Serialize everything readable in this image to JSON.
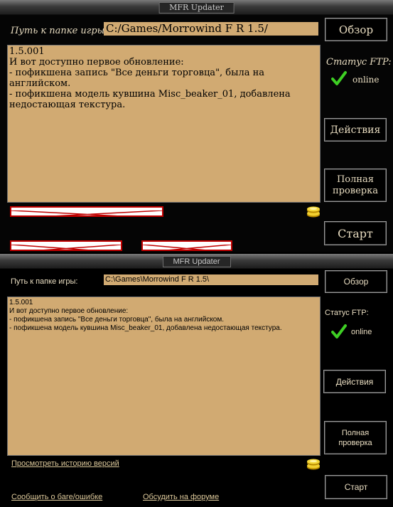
{
  "window_title": "MFR Updater",
  "path_label": "Путь к папке игры:",
  "path_value": "C:/Games/Morrowind F R 1.5/",
  "path_value_alt": "C:\\Games\\Morrowind F R 1.5\\",
  "browse_label": "Обзор",
  "status_label": "Статус FTP:",
  "status_value": "online",
  "actions_label": "Действия",
  "full_check_label_line1": "Полная",
  "full_check_label_line2": "проверка",
  "start_label": "Старт",
  "changelog": "1.5.001\nИ вот доступно первое обновление:\n- пофикшена запись \"Все деньги торговца\", была на английском.\n- пофикшена модель кувшина Misc_beaker_01, добавлена недостающая текстура.",
  "links": {
    "history": "Просмотреть историю версий",
    "report_bug": "Сообщить о баге/ошибке",
    "forum": "Обсудить на форуме"
  },
  "colors": {
    "parchment": "#d1aa72",
    "frame": "#000000",
    "text_light": "#e8dcc0",
    "check_green": "#33cc22"
  },
  "icons": [
    "check-icon",
    "coins-icon",
    "broken-link-placeholder"
  ]
}
